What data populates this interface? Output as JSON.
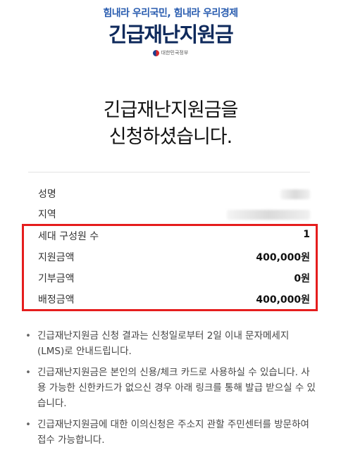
{
  "header": {
    "slogan": "힘내라 우리국민, 힘내라 우리경제",
    "title": "긴급재난지원금",
    "org": "대한민국정부"
  },
  "headline": {
    "line1": "긴급재난지원금을",
    "line2": "신청하셨습니다."
  },
  "info": {
    "name_label": "성명",
    "region_label": "지역",
    "household_label": "세대 구성원 수",
    "household_value": "1",
    "support_label": "지원금액",
    "support_value": "400,000원",
    "donation_label": "기부금액",
    "donation_value": "0원",
    "allocated_label": "배정금액",
    "allocated_value": "400,000원"
  },
  "notes": [
    "긴급재난지원금 신청 결과는 신청일로부터 2일 이내 문자메세지(LMS)로 안내드립니다.",
    "긴급재난지원금은 본인의 신용/체크 카드로 사용하실 수 있습니다. 사용 가능한 신한카드가 없으신 경우 아래 링크를 통해 발급 받으실 수 있습니다.",
    "긴급재난지원금에 대한 이의신청은 주소지 관할 주민센터를 방문하여 접수 가능합니다."
  ]
}
